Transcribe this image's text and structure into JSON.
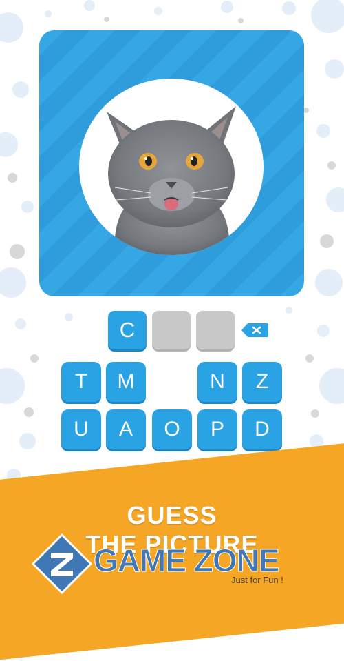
{
  "answer": {
    "slots": [
      {
        "letter": "C",
        "state": "filled"
      },
      {
        "letter": "",
        "state": "empty"
      },
      {
        "letter": "",
        "state": "empty"
      }
    ],
    "backspace_icon": "backspace-x-icon"
  },
  "keyboard": {
    "row1": [
      "T",
      "M",
      "",
      "N",
      "Z"
    ],
    "row2": [
      "U",
      "A",
      "O",
      "P",
      "D"
    ]
  },
  "banner": {
    "line1": "GUESS",
    "line2": "THE PICTURE"
  },
  "watermark": {
    "name": "GAME ZONE",
    "tagline": "Just for Fun !"
  },
  "colors": {
    "primary_blue": "#2aa3e4",
    "card_blue": "#36a7e5",
    "banner_orange": "#f4a624",
    "empty_slot": "#c8c8c8",
    "watermark_blue": "#3f78b4"
  }
}
